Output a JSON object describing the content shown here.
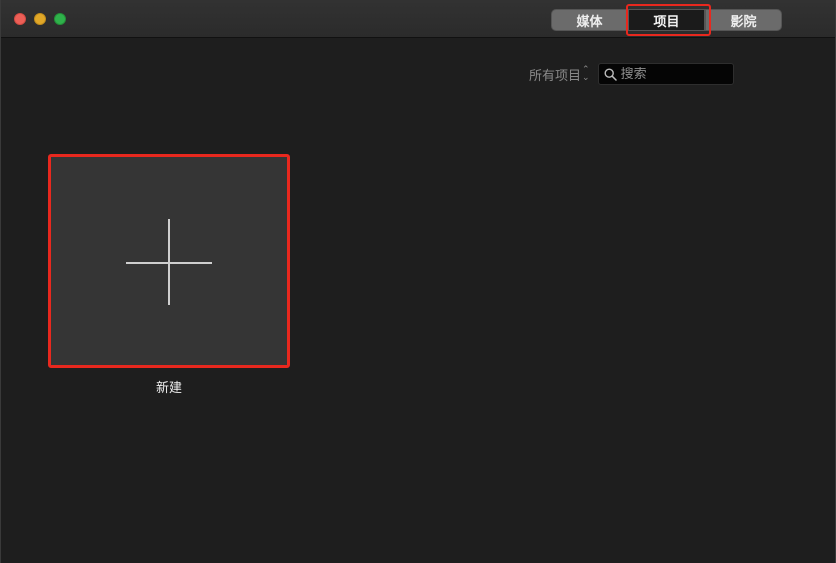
{
  "toolbar": {
    "tabs": [
      {
        "label": "媒体",
        "selected": false
      },
      {
        "label": "项目",
        "selected": true
      },
      {
        "label": "影院",
        "selected": false
      }
    ]
  },
  "filter": {
    "selected_value": "所有项目",
    "arrows_icon": "up-down-chevron-icon"
  },
  "search": {
    "placeholder": "搜索",
    "value": "",
    "icon": "search-icon"
  },
  "projects": {
    "new_label": "新建",
    "new_icon": "plus-icon"
  },
  "colors": {
    "highlight": "#e8281e",
    "background": "#1e1e1e",
    "tile": "#353535"
  }
}
